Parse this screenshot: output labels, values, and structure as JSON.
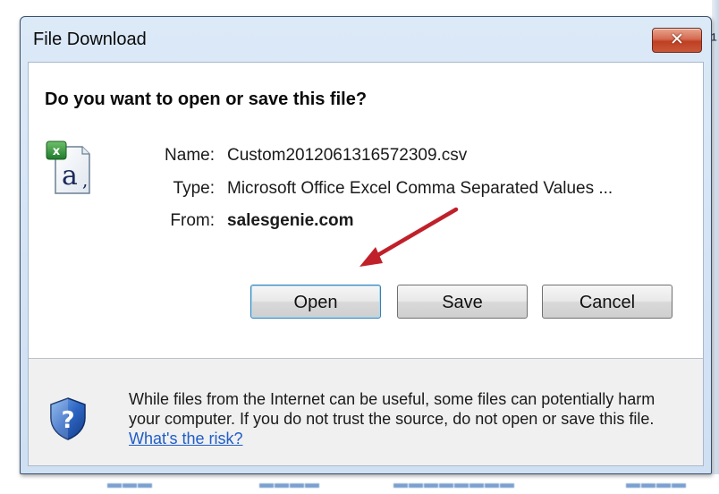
{
  "dialog": {
    "title": "File Download",
    "close_symbol": "✕",
    "heading": "Do you want to open or save this file?",
    "file_icon": "excel-csv-file-icon",
    "fields": {
      "name_label": "Name:",
      "name_value": "Custom2012061316572309.csv",
      "type_label": "Type:",
      "type_value": "Microsoft Office Excel Comma Separated Values ...",
      "from_label": "From:",
      "from_value": "salesgenie.com"
    },
    "buttons": {
      "open": "Open",
      "save": "Save",
      "cancel": "Cancel"
    },
    "warning": {
      "icon": "security-shield-question-icon",
      "text": "While files from the Internet can be useful, some files can potentially harm your computer. If you do not trust the source, do not open or save this file.",
      "link": "What's the risk?"
    },
    "annotation_arrow_color": "#c0202a"
  }
}
